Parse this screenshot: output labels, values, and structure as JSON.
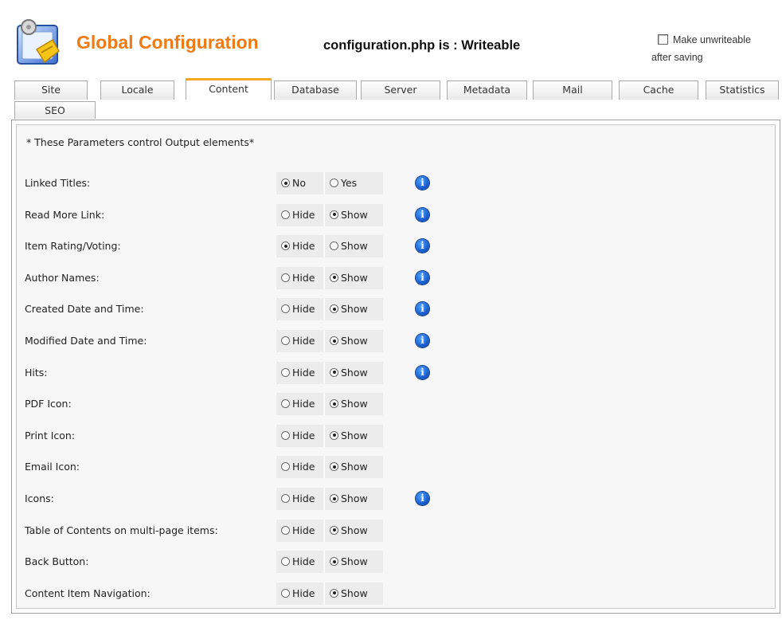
{
  "header": {
    "title": "Global Configuration",
    "status": "configuration.php is : Writeable",
    "unwritable_line1": "Make unwriteable",
    "unwritable_line2": "after saving"
  },
  "tabs": [
    {
      "label": "Site"
    },
    {
      "label": "Locale"
    },
    {
      "label": "Content",
      "active": true
    },
    {
      "label": "Database"
    },
    {
      "label": "Server"
    },
    {
      "label": "Metadata"
    },
    {
      "label": "Mail"
    },
    {
      "label": "Cache"
    },
    {
      "label": "Statistics"
    },
    {
      "label": "SEO"
    }
  ],
  "panel": {
    "note": "* These Parameters control Output elements*",
    "rows": [
      {
        "label": "Linked Titles:",
        "opt1": "No",
        "opt2": "Yes",
        "selected": "opt1",
        "info": true
      },
      {
        "label": "Read More Link:",
        "opt1": "Hide",
        "opt2": "Show",
        "selected": "opt2",
        "info": true
      },
      {
        "label": "Item Rating/Voting:",
        "opt1": "Hide",
        "opt2": "Show",
        "selected": "opt1",
        "info": true
      },
      {
        "label": "Author Names:",
        "opt1": "Hide",
        "opt2": "Show",
        "selected": "opt2",
        "info": true
      },
      {
        "label": "Created Date and Time:",
        "opt1": "Hide",
        "opt2": "Show",
        "selected": "opt2",
        "info": true
      },
      {
        "label": "Modified Date and Time:",
        "opt1": "Hide",
        "opt2": "Show",
        "selected": "opt2",
        "info": true
      },
      {
        "label": "Hits:",
        "opt1": "Hide",
        "opt2": "Show",
        "selected": "opt2",
        "info": true
      },
      {
        "label": "PDF Icon:",
        "opt1": "Hide",
        "opt2": "Show",
        "selected": "opt2",
        "info": false
      },
      {
        "label": "Print Icon:",
        "opt1": "Hide",
        "opt2": "Show",
        "selected": "opt2",
        "info": false
      },
      {
        "label": "Email Icon:",
        "opt1": "Hide",
        "opt2": "Show",
        "selected": "opt2",
        "info": false
      },
      {
        "label": "Icons:",
        "opt1": "Hide",
        "opt2": "Show",
        "selected": "opt2",
        "info": true
      },
      {
        "label": "Table of Contents on multi-page items:",
        "opt1": "Hide",
        "opt2": "Show",
        "selected": "opt2",
        "info": false
      },
      {
        "label": "Back Button:",
        "opt1": "Hide",
        "opt2": "Show",
        "selected": "opt2",
        "info": false
      },
      {
        "label": "Content Item Navigation:",
        "opt1": "Hide",
        "opt2": "Show",
        "selected": "opt2",
        "info": false
      }
    ]
  },
  "colors": {
    "title": "#f07a14",
    "active_tab_accent": "#f5a623",
    "info_icon": "#1a5fd0"
  },
  "icons": {
    "logo": "config-document-icon",
    "info": "info-icon"
  }
}
